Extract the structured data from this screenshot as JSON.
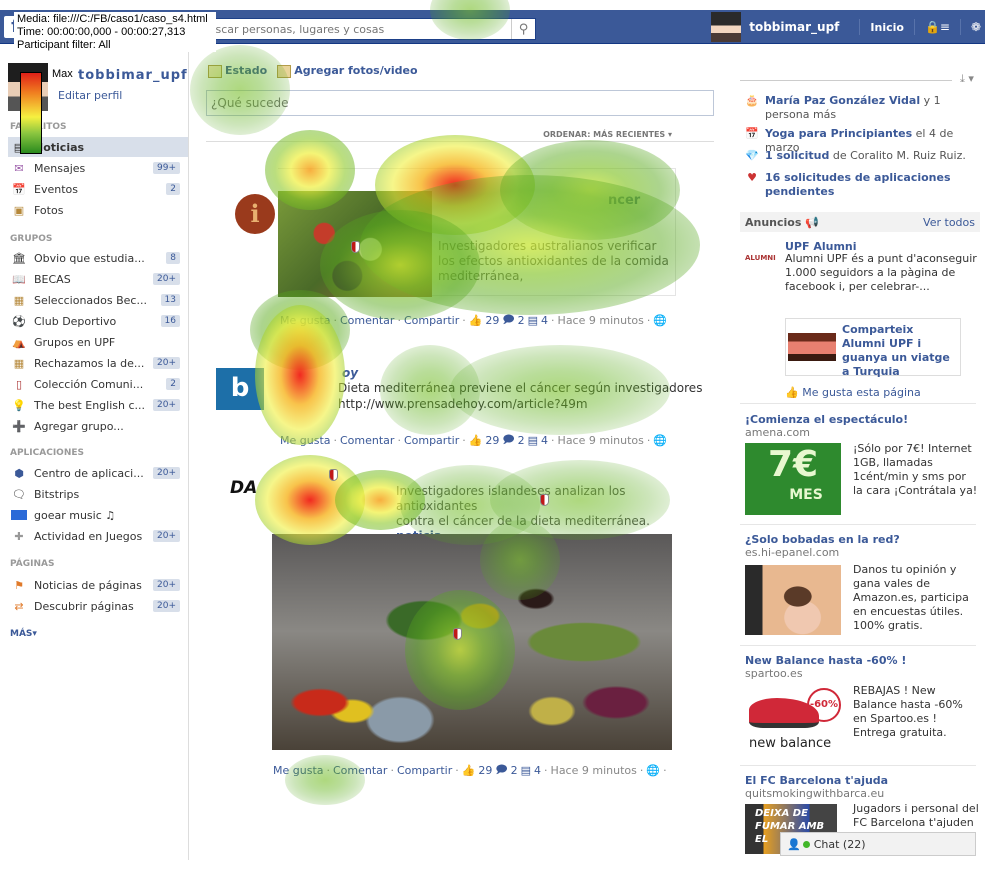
{
  "overlay": {
    "media": "Media: file:///C:/FB/caso1/caso_s4.html",
    "time": "Time: 00:00:00,000 - 00:00:27,313",
    "participant_filter": "Participant filter: All",
    "legend_label": "Max",
    "legend_colors": [
      "#e02018",
      "#f08020",
      "#f6f040",
      "#8cc640",
      "#2a8a1e"
    ]
  },
  "topbar": {
    "logo": "f",
    "search_placeholder": "Buscar personas, lugares y cosas",
    "search_value": "",
    "username": "tobbimar_upf",
    "home_label": "Inicio",
    "brand_color": "#3b5998"
  },
  "sidebar": {
    "profile_name": "tobbimar_upf",
    "edit_profile": "Editar perfil",
    "favorites_head": "FAVORITOS",
    "favorites": [
      {
        "label": "Noticias",
        "count": "",
        "icon": "news-feed-icon"
      },
      {
        "label": "Mensajes",
        "count": "99+",
        "icon": "messages-icon"
      },
      {
        "label": "Eventos",
        "count": "2",
        "icon": "calendar-icon"
      },
      {
        "label": "Fotos",
        "count": "",
        "icon": "photos-icon"
      }
    ],
    "groups_head": "GRUPOS",
    "groups": [
      {
        "label": "Obvio que estudia...",
        "count": "8",
        "icon": "institution-icon"
      },
      {
        "label": "BECAS",
        "count": "20+",
        "icon": "book-icon"
      },
      {
        "label": "Seleccionados Bec...",
        "count": "13",
        "icon": "group-icon"
      },
      {
        "label": "Club Deportivo",
        "count": "16",
        "icon": "soccer-ball-icon"
      },
      {
        "label": "Grupos en UPF",
        "count": "",
        "icon": "campus-icon"
      },
      {
        "label": "Rechazamos la de...",
        "count": "20+",
        "icon": "group-icon"
      },
      {
        "label": "Colección Comuni...",
        "count": "2",
        "icon": "library-icon"
      },
      {
        "label": "The best English c...",
        "count": "20+",
        "icon": "lightbulb-icon"
      },
      {
        "label": "Agregar grupo...",
        "count": "",
        "icon": "add-group-icon"
      }
    ],
    "apps_head": "APLICACIONES",
    "apps": [
      {
        "label": "Centro de aplicaci...",
        "count": "20+",
        "icon": "app-center-icon"
      },
      {
        "label": "Bitstrips",
        "count": "",
        "icon": "speech-bubble-icon"
      },
      {
        "label": "goear music ♫",
        "count": "",
        "icon": "goear-icon"
      },
      {
        "label": "Actividad en Juegos",
        "count": "20+",
        "icon": "games-icon"
      }
    ],
    "pages_head": "PÁGINAS",
    "pages": [
      {
        "label": "Noticias de páginas",
        "count": "20+",
        "icon": "flag-icon"
      },
      {
        "label": "Descubrir páginas",
        "count": "20+",
        "icon": "discover-pages-icon"
      }
    ],
    "more": "MÁS▾"
  },
  "composer": {
    "status_tab": "Estado",
    "photo_tab": "Agregar fotos/video",
    "placeholder": "¿Qué sucede",
    "sort_label": "ORDENAR: MÁS RECIENTES ▾"
  },
  "posts": [
    {
      "avatar": "i",
      "title_fragment": "ncer",
      "desc": "Investigadores australianos verificar los efectos antioxidantes de la comida mediterránea,",
      "actions": {
        "like": "Me gusta",
        "comment": "Comentar",
        "share": "Compartir",
        "likes": "29",
        "comments": "2",
        "shares": "4",
        "time": "Hace 9 minutos"
      }
    },
    {
      "avatar": "b",
      "name_fragment": "oy",
      "text_line1": "Dieta mediterránea previene el  cáncer según investigadores",
      "text_line2": "http://www.prensadehoy.com/article?49m",
      "actions": {
        "like": "Me gusta",
        "comment": "Comentar",
        "share": "Compartir",
        "likes": "29",
        "comments": "2",
        "shares": "4",
        "time": "Hace 9 minutos"
      }
    },
    {
      "brand": "DA",
      "text_line1": "Investigadores islandeses analizan los antioxidantes",
      "text_line2": "contra el cáncer de la dieta mediterránea.",
      "text_line3": "noticia",
      "actions": {
        "like": "Me gusta",
        "comment": "Comentar",
        "share": "Compartir",
        "likes": "29",
        "comments": "2",
        "shares": "4",
        "time": "Hace 9 minutos"
      }
    }
  ],
  "right": {
    "reminders": [
      {
        "icon": "birthday-cake-icon",
        "bold": "María Paz González Vidal",
        "rest": "  y 1 persona más"
      },
      {
        "icon": "calendar-icon",
        "bold": "Yoga para Principiantes",
        "rest": " el 4 de marzo"
      },
      {
        "icon": "gem-icon",
        "bold": "1 solicitud",
        "rest": " de Coralito M. Ruiz Ruiz."
      },
      {
        "icon": "app-request-icon",
        "bold": "16 solicitudes de aplicaciones pendientes",
        "rest": ""
      }
    ],
    "ads_title": "Anuncios",
    "ads_see_all": "Ver todos",
    "alumni": {
      "logo": "ALUMNI",
      "title": "UPF Alumni",
      "body": "Alumni UPF és a punt d'aconseguir 1.000 seguidors a la pàgina de facebook i, per celebrar-...",
      "card_title": "Comparteix Alumni UPF i guanya un viatge a Turquia",
      "like": "Me gusta esta página"
    },
    "ads": [
      {
        "title": "¡Comienza el espectáculo!",
        "domain": "amena.com",
        "body": "¡Sólo por 7€! Internet 1GB, llamadas 1cént/min y sms por la cara ¡Contrátala ya!",
        "img_text": "7€",
        "img_sub": "MES"
      },
      {
        "title": "¿Solo bobadas en la red?",
        "domain": "es.hi-epanel.com",
        "body": "Danos tu opinión y gana vales de Amazon.es, participa en encuestas útiles. 100% gratis."
      },
      {
        "title": "New Balance hasta -60% !",
        "domain": "spartoo.es",
        "body": "REBAJAS ! New Balance hasta -60% en Spartoo.es ! Entrega gratuita.",
        "img_badge": "-60%",
        "img_brand": "new balance"
      },
      {
        "title": "El FC Barcelona t'ajuda",
        "domain": "quitsmokingwithbarca.eu",
        "body": "Jugadors i personal del FC Barcelona t'ajuden a",
        "img_text": "DEIXA DE FUMAR AMB EL"
      }
    ],
    "chat_label": "Chat (22)"
  }
}
